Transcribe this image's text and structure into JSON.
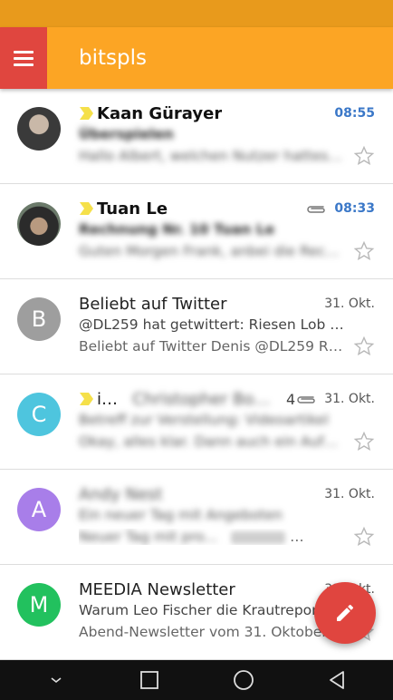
{
  "app": {
    "title": "bitspls"
  },
  "colors": {
    "accent": "#fca524",
    "status_bar": "#e89a1c",
    "menu": "#e0463f",
    "fab": "#e0453f",
    "unread_date": "#3b78c8"
  },
  "emails": [
    {
      "sender": "Kaan Gürayer",
      "subject": "Überspielen",
      "preview": "Hallo Albert, welchen Nutzer hattest du mit dem...",
      "date": "08:55",
      "unread": true,
      "important": true,
      "attachment": false,
      "avatar": "photo"
    },
    {
      "sender": "Tuan Le",
      "subject": "Rechnung Nr. 10 Tuan Le",
      "preview": "Guten Morgen Frank, anbei die Rechnung...",
      "date": "08:33",
      "unread": true,
      "important": true,
      "attachment": true,
      "avatar": "photo"
    },
    {
      "sender": "Beliebt auf Twitter",
      "subject": "@DL259 hat getwittert: Riesen Lob an ...",
      "preview": "Beliebt auf Twitter Denis @DL259 Riesen ...",
      "date": "31. Okt.",
      "unread": false,
      "important": false,
      "attachment": false,
      "avatar_letter": "B",
      "avatar_color": "#9e9e9e"
    },
    {
      "sender_visible": "ich,",
      "sender_blurred": "Christopher Bobel",
      "count": "4",
      "subject": "Betreff zur Verstellung: Videoartikel",
      "preview": "Okay, alles klar. Dann auch ein Aufnehmen...",
      "date": "31. Okt.",
      "unread": false,
      "important": true,
      "attachment": true,
      "avatar_letter": "C",
      "avatar_color": "#4ec5de"
    },
    {
      "sender": "Andy Nest",
      "subject": "Ein neuer Tag mit Angeboten",
      "preview": "Neuer Tag mit pro...",
      "date": "31. Okt.",
      "unread": false,
      "important": false,
      "attachment": false,
      "avatar_letter": "A",
      "avatar_color": "#a87ee9"
    },
    {
      "sender": "MEEDIA Newsletter",
      "subject": "Warum Leo Fischer die Krautreporter ...",
      "preview": "Abend-Newsletter vom 31. Oktober 2014",
      "date": "31. Okt.",
      "unread": false,
      "important": false,
      "attachment": false,
      "avatar_letter": "M",
      "avatar_color": "#22c15e"
    }
  ],
  "icons": {
    "menu": "hamburger-icon",
    "compose": "pencil-icon",
    "star": "star-outline-icon",
    "attachment": "paperclip-icon",
    "importance": "importance-marker-icon"
  }
}
